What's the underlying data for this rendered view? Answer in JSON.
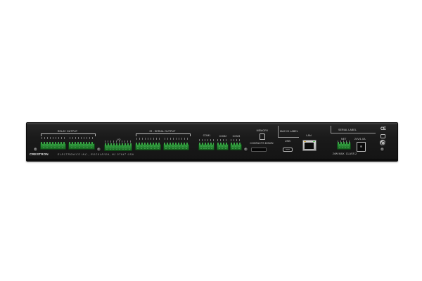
{
  "device": {
    "brand": "CRESTRON",
    "address": "ELECTRONICS INC., ROCKLEIGH, NJ 07647 USA",
    "colors": {
      "chassis": "#1a1a1a",
      "terminal_green": "#23832f",
      "label_white": "#d6d6d6",
      "background": "#ffffff"
    }
  },
  "rear_panel": {
    "relay_output_label": "RELAY OUTPUT",
    "io_label": "I/O",
    "ir_serial_output_label": "IR - SERIAL OUTPUT",
    "com1_label": "COM1",
    "com2_label": "COM2",
    "com3_label": "COM3",
    "memory_label": "MEMORY",
    "contacts_down_label": "CONTACTS DOWN",
    "mac_id_label": "MAC ID LABEL",
    "usb_label": "USB",
    "lan_label": "LAN",
    "serial_label": "SERIAL LABEL",
    "net_label": "NET",
    "power_rating_label": "24V/1.0A",
    "power_class_label": "24W MAX. CLASS 2",
    "ce_mark": "CE"
  }
}
